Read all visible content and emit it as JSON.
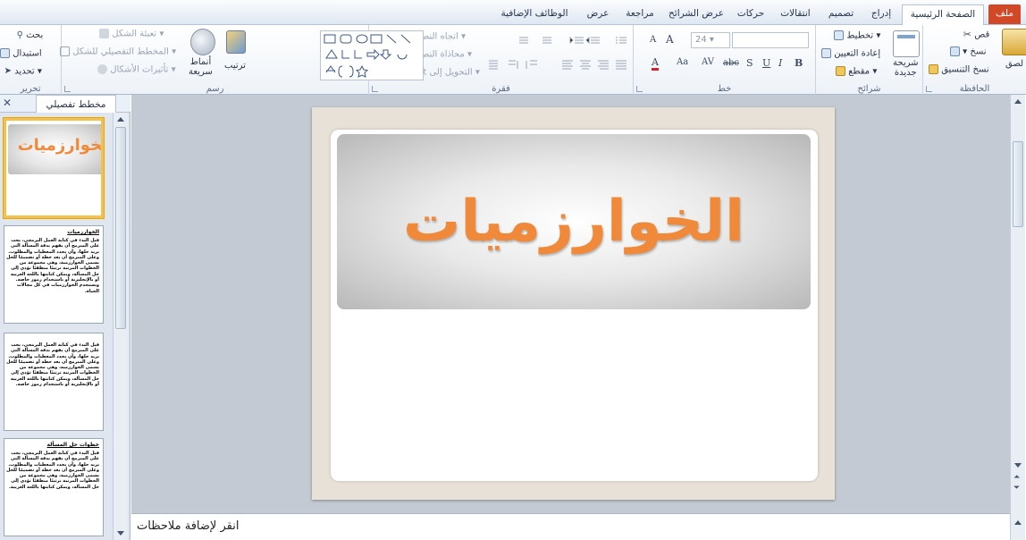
{
  "ribbon_tabs": {
    "file": "ملف",
    "home": "الصفحة الرئيسية",
    "insert": "إدراج",
    "design": "تصميم",
    "transitions": "انتقالات",
    "animations": "حركات",
    "slideshow": "عرض الشرائح",
    "review": "مراجعة",
    "view": "عرض",
    "addins": "الوظائف الإضافية"
  },
  "clipboard": {
    "paste": "لصق",
    "cut": "قص",
    "copy": "نسخ",
    "format_painter": "نسخ التنسيق",
    "label": "الحافظة"
  },
  "slides": {
    "new_slide_line1": "شريحة",
    "new_slide_line2": "جديدة",
    "layout": "تخطيط",
    "reset": "إعادة التعيين",
    "section": "مقطع",
    "label": "شرائح"
  },
  "font": {
    "size": "24",
    "label": "خط",
    "bold": "B",
    "italic": "I",
    "underline": "U",
    "shadow": "S",
    "strike": "abc",
    "spacing": "AV",
    "case": "Aa",
    "color": "A",
    "grow": "A",
    "shrink": "A"
  },
  "paragraph": {
    "text_direction": "اتجاه النص",
    "align_text": "محاذاة النص",
    "smartart": "التحويل إلى SmartArt",
    "label": "فقرة"
  },
  "drawing": {
    "arrange": "ترتيب",
    "quick_styles_line1": "أنماط",
    "quick_styles_line2": "سريعة",
    "shape_fill": "تعبئة الشكل",
    "shape_outline": "المخطط التفصيلي للشكل",
    "shape_effects": "تأثيرات الأشكال",
    "label": "رسم"
  },
  "editing": {
    "find": "بحث",
    "replace": "استبدال",
    "select": "تحديد",
    "label": "تحرير"
  },
  "left_pane": {
    "outline_tab": "مخطط تفصيلي",
    "close": "✕"
  },
  "thumbnails": [
    {
      "title": "الخوارزميات"
    },
    {
      "heading": "الخوارزميات",
      "body": "قبل البدء في كتابة العمل البرمجي، يجب على المبرمج أن يفهم بدقة المسألة التي يريد حلها، وأن يحدد المعطيات والمطلوب. وعلى المبرمج أن يعد خطة أو تصميمًا للحل يسمى الخوارزمية، وهي مجموعة من الخطوات المرتبة ترتيبًا منطقيًا تؤدي إلى حل المسألة، ويمكن كتابتها باللغة العربية أو بالإنجليزية أو باستخدام رموز خاصة. وتستخدم الخوارزميات في كل مجالات الحياة."
    },
    {
      "body": "قبل البدء في كتابة العمل البرمجي، يجب على المبرمج أن يفهم بدقة المسألة التي يريد حلها، وأن يحدد المعطيات والمطلوب. وعلى المبرمج أن يعد خطة أو تصميمًا للحل يسمى الخوارزمية، وهي مجموعة من الخطوات المرتبة ترتيبًا منطقيًا تؤدي إلى حل المسألة، ويمكن كتابتها باللغة العربية أو بالإنجليزية أو باستخدام رموز خاصة."
    },
    {
      "heading": "خطوات حل المسألة",
      "body": "قبل البدء في كتابة العمل البرمجي، يجب على المبرمج أن يفهم بدقة المسألة التي يريد حلها، وأن يحدد المعطيات والمطلوب. وعلى المبرمج أن يعد خطة أو تصميمًا للحل يسمى الخوارزمية، وهي مجموعة من الخطوات المرتبة ترتيبًا منطقيًا تؤدي إلى حل المسألة، ويمكن كتابتها باللغة العربية."
    }
  ],
  "slide": {
    "title": "الخوارزميات"
  },
  "notes": {
    "placeholder": "انقر لإضافة ملاحظات"
  },
  "colors": {
    "file_tab": "#d24726",
    "title_text": "#f08a3a",
    "selected_thumb": "#f2c14e"
  }
}
